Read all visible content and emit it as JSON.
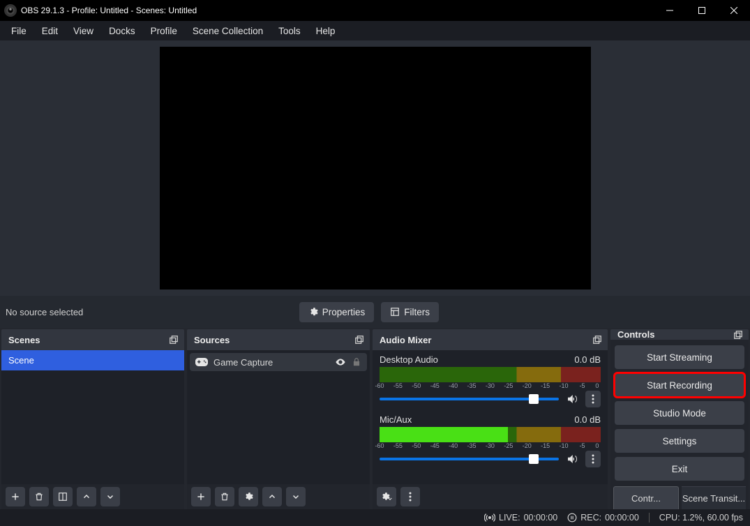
{
  "titlebar": {
    "title": "OBS 29.1.3 - Profile: Untitled - Scenes: Untitled"
  },
  "menu": {
    "file": "File",
    "edit": "Edit",
    "view": "View",
    "docks": "Docks",
    "profile": "Profile",
    "scene_collection": "Scene Collection",
    "tools": "Tools",
    "help": "Help"
  },
  "propbar": {
    "no_source": "No source selected",
    "properties": "Properties",
    "filters": "Filters"
  },
  "scenes": {
    "title": "Scenes",
    "items": [
      "Scene"
    ]
  },
  "sources": {
    "title": "Sources",
    "items": [
      {
        "icon": "gamepad",
        "label": "Game Capture"
      }
    ]
  },
  "mixer": {
    "title": "Audio Mixer",
    "channels": [
      {
        "name": "Desktop Audio",
        "db": "0.0 dB",
        "ticks": [
          "-60",
          "-55",
          "-50",
          "-45",
          "-40",
          "-35",
          "-30",
          "-25",
          "-20",
          "-15",
          "-10",
          "-5",
          "0"
        ]
      },
      {
        "name": "Mic/Aux",
        "db": "0.0 dB",
        "ticks": [
          "-60",
          "-55",
          "-50",
          "-45",
          "-40",
          "-35",
          "-30",
          "-25",
          "-20",
          "-15",
          "-10",
          "-5",
          "0"
        ]
      }
    ]
  },
  "controls": {
    "title": "Controls",
    "start_streaming": "Start Streaming",
    "start_recording": "Start Recording",
    "studio_mode": "Studio Mode",
    "settings": "Settings",
    "exit": "Exit",
    "tab_controls": "Contr...",
    "tab_transitions": "Scene Transit..."
  },
  "status": {
    "live_label": "LIVE:",
    "live_time": "00:00:00",
    "rec_label": "REC:",
    "rec_time": "00:00:00",
    "cpu": "CPU: 1.2%, 60.00 fps"
  }
}
